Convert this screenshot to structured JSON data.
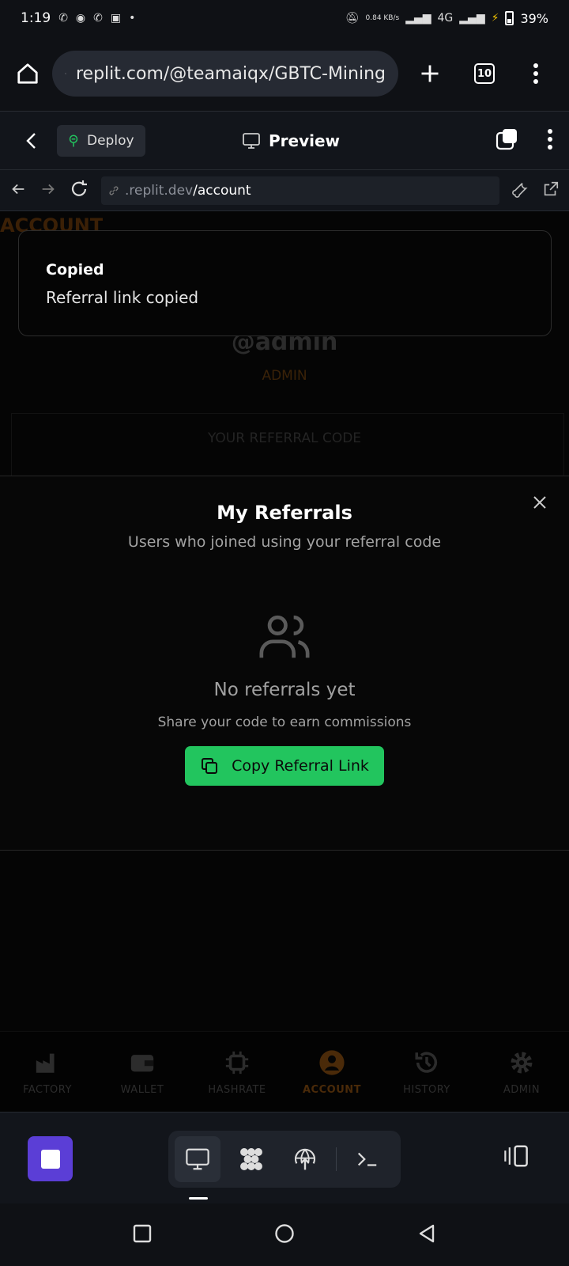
{
  "status": {
    "time": "1:19",
    "network": "4G",
    "speed": "0.84 KB/s",
    "battery": "39%"
  },
  "browser": {
    "url": "replit.com/@teamaiqx/GBTC-Mining",
    "tab_count": "10"
  },
  "replit": {
    "deploy_label": "Deploy",
    "preview_label": "Preview"
  },
  "webview": {
    "domain": ".replit.dev",
    "path": "/account"
  },
  "page": {
    "title": "ACCOUNT",
    "username": "@admin",
    "role": "ADMIN",
    "referral_label": "YOUR REFERRAL CODE"
  },
  "toast": {
    "title": "Copied",
    "message": "Referral link copied"
  },
  "modal": {
    "title": "My Referrals",
    "subtitle": "Users who joined using your referral code",
    "empty_title": "No referrals yet",
    "empty_subtitle": "Share your code to earn commissions",
    "copy_button": "Copy Referral Link"
  },
  "nav": {
    "items": [
      {
        "label": "FACTORY",
        "icon": "factory-icon"
      },
      {
        "label": "WALLET",
        "icon": "wallet-icon"
      },
      {
        "label": "HASHRATE",
        "icon": "chip-icon"
      },
      {
        "label": "ACCOUNT",
        "icon": "user-icon",
        "active": true
      },
      {
        "label": "HISTORY",
        "icon": "history-icon"
      },
      {
        "label": "ADMIN",
        "icon": "gear-icon"
      }
    ]
  },
  "colors": {
    "accent_green": "#22c55e",
    "accent_orange": "#f97316",
    "stop_purple": "#5b3ed6"
  }
}
